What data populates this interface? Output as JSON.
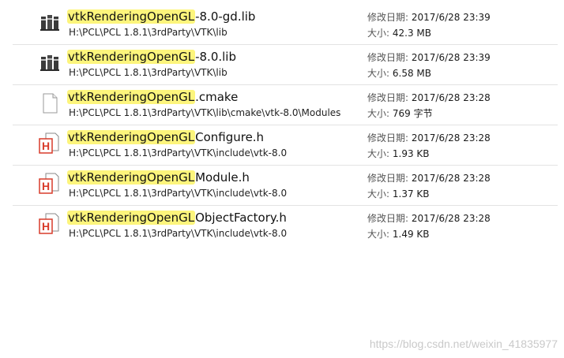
{
  "labels": {
    "modified": "修改日期:",
    "size": "大小:"
  },
  "files": [
    {
      "name_hl": "vtkRenderingOpenGL",
      "name_rest": "-8.0-gd.lib",
      "path": "H:\\PCL\\PCL 1.8.1\\3rdParty\\VTK\\lib",
      "modified": "2017/6/28 23:39",
      "size": "42.3 MB",
      "icon": "library-icon"
    },
    {
      "name_hl": "vtkRenderingOpenGL",
      "name_rest": "-8.0.lib",
      "path": "H:\\PCL\\PCL 1.8.1\\3rdParty\\VTK\\lib",
      "modified": "2017/6/28 23:39",
      "size": "6.58 MB",
      "icon": "library-icon"
    },
    {
      "name_hl": "vtkRenderingOpenGL",
      "name_rest": ".cmake",
      "path": "H:\\PCL\\PCL 1.8.1\\3rdParty\\VTK\\lib\\cmake\\vtk-8.0\\Modules",
      "modified": "2017/6/28 23:28",
      "size": "769 字节",
      "icon": "blank-file-icon"
    },
    {
      "name_hl": "vtkRenderingOpenGL",
      "name_rest": "Configure.h",
      "path": "H:\\PCL\\PCL 1.8.1\\3rdParty\\VTK\\include\\vtk-8.0",
      "modified": "2017/6/28 23:28",
      "size": "1.93 KB",
      "icon": "header-file-icon"
    },
    {
      "name_hl": "vtkRenderingOpenGL",
      "name_rest": "Module.h",
      "path": "H:\\PCL\\PCL 1.8.1\\3rdParty\\VTK\\include\\vtk-8.0",
      "modified": "2017/6/28 23:28",
      "size": "1.37 KB",
      "icon": "header-file-icon"
    },
    {
      "name_hl": "vtkRenderingOpenGL",
      "name_rest": "ObjectFactory.h",
      "path": "H:\\PCL\\PCL 1.8.1\\3rdParty\\VTK\\include\\vtk-8.0",
      "modified": "2017/6/28 23:28",
      "size": "1.49 KB",
      "icon": "header-file-icon"
    }
  ],
  "watermark": "https://blog.csdn.net/weixin_41835977",
  "colors": {
    "highlight": "#fdf57c",
    "header_icon_red": "#d83b2a"
  }
}
